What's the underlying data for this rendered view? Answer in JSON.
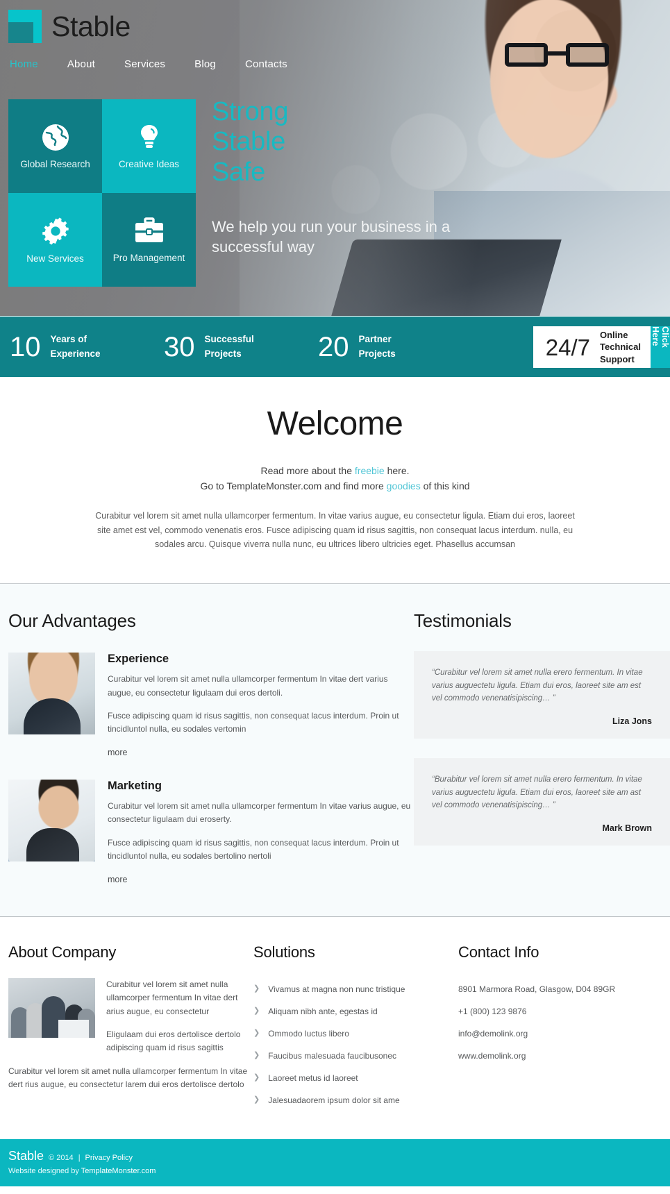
{
  "brand": {
    "name": "Stable",
    "logo_icon": "stable-squares-logo"
  },
  "nav": {
    "items": [
      {
        "label": "Home",
        "active": true
      },
      {
        "label": "About",
        "active": false
      },
      {
        "label": "Services",
        "active": false
      },
      {
        "label": "Blog",
        "active": false
      },
      {
        "label": "Contacts",
        "active": false
      }
    ]
  },
  "hero": {
    "headline_lines": [
      "Strong",
      "Stable",
      "Safe"
    ],
    "subtext": "We help you run your business in a successful way",
    "tiles": [
      {
        "label": "Global Research",
        "icon": "globe-icon",
        "tone": "dark"
      },
      {
        "label": "Creative Ideas",
        "icon": "lightbulb-icon",
        "tone": "light"
      },
      {
        "label": "New Services",
        "icon": "gear-icon",
        "tone": "light"
      },
      {
        "label": "Pro Management",
        "icon": "briefcase-icon",
        "tone": "dark"
      }
    ]
  },
  "stats": {
    "items": [
      {
        "number": "10",
        "caption_line1": "Years of",
        "caption_line2": "Experience"
      },
      {
        "number": "30",
        "caption_line1": "Successful",
        "caption_line2": "Projects"
      },
      {
        "number": "20",
        "caption_line1": "Partner",
        "caption_line2": "Projects"
      }
    ],
    "support": {
      "number": "24/7",
      "text_line1": "Online",
      "text_line2": "Technical",
      "text_line3": "Support",
      "cta": "Click Here"
    }
  },
  "welcome": {
    "title": "Welcome",
    "lead_1_pre": "Read more about the ",
    "lead_1_link": "freebie",
    "lead_1_post": " here.",
    "lead_2_pre": "Go to TemplateMonster.com and find more ",
    "lead_2_link": "goodies",
    "lead_2_post": " of this kind",
    "body": "Curabitur vel lorem sit amet nulla ullamcorper fermentum. In vitae varius augue, eu consectetur ligula. Etiam dui eros, laoreet site amet est vel, commodo venenatis eros. Fusce adipiscing quam id risus sagittis, non consequat lacus interdum. nulla, eu sodales arcu. Quisque viverra nulla nunc, eu ultrices libero ultricies eget. Phasellus accumsan"
  },
  "advantages": {
    "title": "Our Advantages",
    "items": [
      {
        "title": "Experience",
        "p1": "Curabitur vel lorem sit amet nulla ullamcorper fermentum In vitae dert varius augue, eu consectetur ligulaam dui eros dertoli.",
        "p2": "Fusce adipiscing quam id risus sagittis, non consequat lacus interdum. Proin ut tincidluntol nulla, eu sodales vertomin",
        "more": "more"
      },
      {
        "title": "Marketing",
        "p1": "Curabitur vel lorem sit amet nulla ullamcorper fermentum In vitae varius augue, eu consectetur ligulaam dui eroserty.",
        "p2": "Fusce adipiscing quam id risus sagittis, non consequat lacus interdum. Proin ut tincidluntol nulla, eu sodales bertolino nertoli",
        "more": "more"
      }
    ]
  },
  "testimonials": {
    "title": "Testimonials",
    "items": [
      {
        "quote": "“Curabitur vel lorem sit amet nulla erero fermentum. In vitae varius auguectetu ligula. Etiam dui eros, laoreet site am est vel commodo venenatisipiscing… ”",
        "author": "Liza Jons"
      },
      {
        "quote": "“Burabitur vel lorem sit amet nulla erero fermentum. In vitae varius auguectetu ligula. Etiam dui eros, laoreet site am ast vel commodo venenatisipiscing… ”",
        "author": "Mark Brown"
      }
    ]
  },
  "footer": {
    "about": {
      "title": "About Company",
      "p1": "Curabitur vel lorem sit amet nulla ullamcorper fermentum In vitae dert arius augue, eu consectetur",
      "p2": "Eligulaam dui eros dertolisce dertolo adipiscing quam id risus sagittis",
      "bottom": "Curabitur vel lorem sit amet nulla ullamcorper fermentum In vitae dert rius augue, eu consectetur larem dui eros dertolisce dertolo"
    },
    "solutions": {
      "title": "Solutions",
      "items": [
        "Vivamus at magna non nunc tristique",
        "Aliquam nibh ante, egestas id",
        "Ommodo luctus libero",
        "Faucibus malesuada faucibusonec",
        "Laoreet metus id laoreet",
        "Jalesuadaorem ipsum dolor sit ame"
      ]
    },
    "contact": {
      "title": "Contact Info",
      "items": [
        "8901 Marmora Road, Glasgow, D04 89GR",
        "+1 (800) 123 9876",
        "info@demolink.org",
        "www.demolink.org"
      ]
    },
    "bottom": {
      "brand": "Stable",
      "copyright": "© 2014",
      "separator": "|",
      "privacy": "Privacy Policy",
      "designed_pre": "Website designed by ",
      "designed_link": "TemplateMonster.com"
    }
  },
  "colors": {
    "teal_dark": "#0f8289",
    "teal_light": "#0bb7c0",
    "accent_text": "#18b9c2",
    "link": "#52c6d6"
  }
}
